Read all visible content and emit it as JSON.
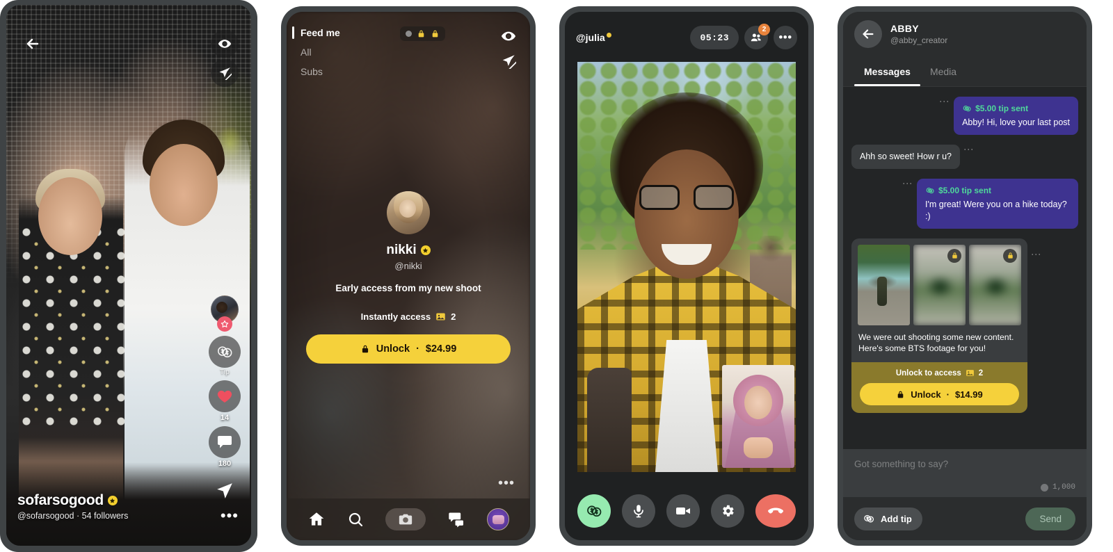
{
  "phone1": {
    "name": "post-viewer",
    "topbar": {
      "back": "back-arrow",
      "eye": "eye",
      "mute": "mute"
    },
    "rail": {
      "tip_label": "Tip",
      "like_count": "14",
      "comment_count": "180"
    },
    "creator": {
      "display_name": "sofarsogood",
      "handle": "@sofarsogood",
      "separator": "·",
      "followers": "54 followers"
    },
    "more": "•••"
  },
  "phone2": {
    "name": "feed",
    "tabs": [
      {
        "label": "Feed me",
        "active": true
      },
      {
        "label": "All",
        "active": false
      },
      {
        "label": "Subs",
        "active": false
      }
    ],
    "status_pills": [
      "dot",
      "lock",
      "lock"
    ],
    "card": {
      "display_name": "nikki",
      "handle": "@nikki",
      "description": "Early access from my new shoot",
      "instant_label": "Instantly access",
      "instant_count": "2",
      "unlock_label": "Unlock",
      "unlock_separator": "·",
      "unlock_price": "$24.99"
    },
    "more": "•••",
    "nav": [
      {
        "icon": "home-icon",
        "label": "Home"
      },
      {
        "icon": "search-icon",
        "label": "Search"
      },
      {
        "icon": "camera-icon",
        "label": "Camera"
      },
      {
        "icon": "chat-icon",
        "label": "Messages"
      },
      {
        "icon": "profile-icon",
        "label": "Profile"
      }
    ]
  },
  "phone3": {
    "name": "video-call",
    "handle": "@julia",
    "timer": "05:23",
    "viewers_badge": "2",
    "more": "•••",
    "controls": [
      {
        "icon": "tip-money-icon",
        "label": "Tip"
      },
      {
        "icon": "microphone-icon",
        "label": "Mute"
      },
      {
        "icon": "video-camera-icon",
        "label": "Camera"
      },
      {
        "icon": "gear-icon",
        "label": "Settings"
      },
      {
        "icon": "end-call-icon",
        "label": "End call"
      }
    ]
  },
  "phone4": {
    "name": "direct-messages",
    "header": {
      "display_name": "ABBY",
      "handle": "@abby_creator"
    },
    "tabs": [
      {
        "label": "Messages",
        "active": true
      },
      {
        "label": "Media",
        "active": false
      }
    ],
    "messages": [
      {
        "direction": "out",
        "tip": "$5.00 tip sent",
        "text": "Abby! Hi, love your last post"
      },
      {
        "direction": "in",
        "tip": "",
        "text": "Ahh so sweet! How r u?"
      },
      {
        "direction": "out",
        "tip": "$5.00 tip sent",
        "text": "I'm great! Were you on a hike today? :)"
      }
    ],
    "media_card": {
      "caption": "We were out shooting some new content. Here's some BTS footage for you!",
      "unlock_label": "Unlock to access",
      "unlock_count": "2",
      "button_label": "Unlock",
      "button_separator": "·",
      "button_price": "$14.99"
    },
    "compose": {
      "placeholder": "Got something to say?",
      "char_counter": "1,000",
      "add_tip_label": "Add tip",
      "send_label": "Send"
    }
  }
}
